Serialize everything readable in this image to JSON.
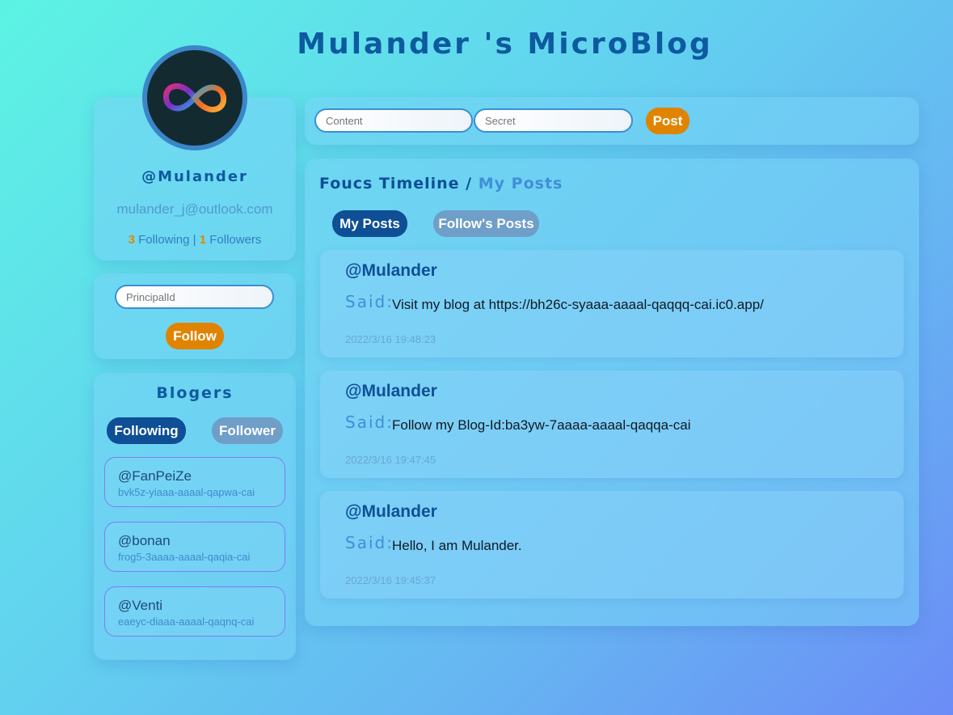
{
  "header": {
    "title": "Mulander 's MicroBlog"
  },
  "profile": {
    "username": "@Mulander",
    "email": "mulander_j@outlook.com",
    "following_count": "3",
    "following_label": "Following",
    "separator": "|",
    "followers_count": "1",
    "followers_label": "Followers"
  },
  "follow_box": {
    "principal_placeholder": "PrincipalId",
    "follow_label": "Follow"
  },
  "blogers": {
    "title": "Blogers",
    "tabs": {
      "following": "Following",
      "follower": "Follower"
    },
    "items": [
      {
        "name": "@FanPeiZe",
        "id": "bvk5z-yiaaa-aaaal-qapwa-cai"
      },
      {
        "name": "@bonan",
        "id": "frog5-3aaaa-aaaal-qaqia-cai"
      },
      {
        "name": "@Venti",
        "id": "eaeyc-diaaa-aaaal-qaqnq-cai"
      }
    ]
  },
  "composer": {
    "content_placeholder": "Content",
    "secret_placeholder": "Secret",
    "post_label": "Post"
  },
  "timeline": {
    "heading_main": "Foucs Timeline /",
    "heading_sub": "My Posts",
    "tabs": {
      "my_posts": "My Posts",
      "follows_posts": "Follow's Posts"
    },
    "said_label": "Said:",
    "posts": [
      {
        "author": "@Mulander",
        "content": "Visit my blog at https://bh26c-syaaa-aaaal-qaqqq-cai.ic0.app/",
        "time": "2022/3/16 19:48:23"
      },
      {
        "author": "@Mulander",
        "content": "Follow my Blog-Id:ba3yw-7aaaa-aaaal-qaqqa-cai",
        "time": "2022/3/16 19:47:45"
      },
      {
        "author": "@Mulander",
        "content": "Hello, I am Mulander.",
        "time": "2022/3/16 19:45:37"
      }
    ]
  },
  "colors": {
    "accent_orange": "#e08400",
    "primary_blue": "#0e4f96",
    "inactive_tab": "#6f9ec8"
  }
}
